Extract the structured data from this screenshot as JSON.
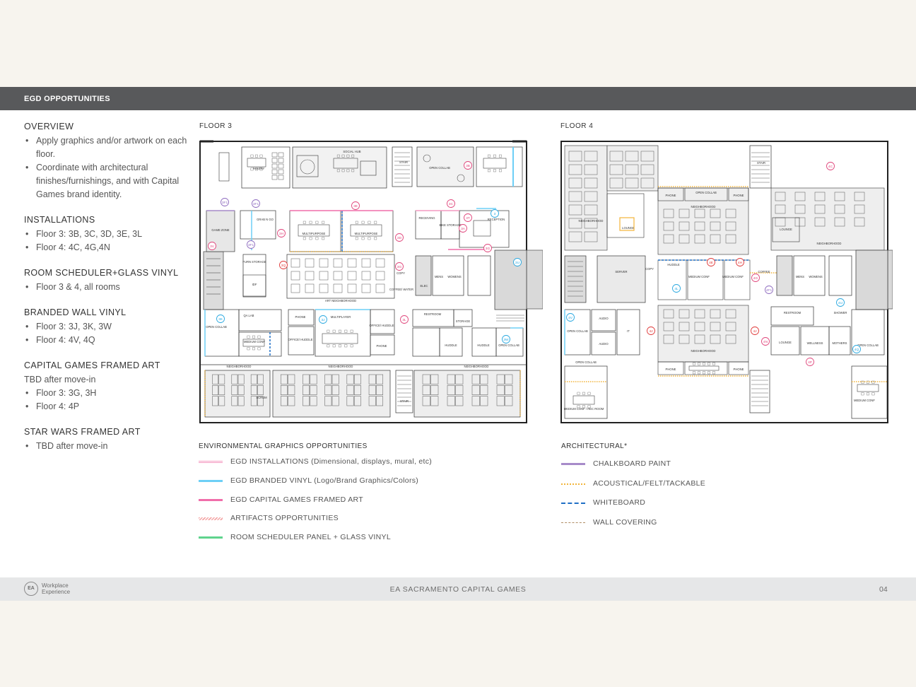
{
  "header": {
    "title": "EGD OPPORTUNITIES"
  },
  "sidebar": {
    "sections": [
      {
        "title": "OVERVIEW",
        "sub": "",
        "items": [
          "Apply graphics and/or artwork on each floor.",
          "Coordinate with architectural finishes/furnishings, and with Capital Games brand identity."
        ]
      },
      {
        "title": "INSTALLATIONS",
        "sub": "",
        "items": [
          "Floor 3: 3B, 3C, 3D, 3E, 3L",
          "Floor 4: 4C, 4G,4N"
        ]
      },
      {
        "title": "ROOM SCHEDULER+GLASS VINYL",
        "sub": "",
        "items": [
          "Floor 3 & 4, all rooms"
        ]
      },
      {
        "title": "BRANDED WALL VINYL",
        "sub": "",
        "items": [
          "Floor 3: 3J, 3K, 3W",
          "Floor 4: 4V, 4Q"
        ]
      },
      {
        "title": "CAPITAL GAMES FRAMED ART",
        "sub": "TBD after move-in",
        "items": [
          "Floor 3: 3G, 3H",
          "Floor 4: 4P"
        ]
      },
      {
        "title": "STAR WARS FRAMED ART",
        "sub": "",
        "items": [
          "TBD after move-in"
        ]
      }
    ]
  },
  "floors": {
    "floor3": {
      "label": "FLOOR 3",
      "rooms": [
        "PANTRY",
        "SOCIAL HUB",
        "STAIR",
        "OPEN COLLAB",
        "GAME ZONE",
        "GRAB N GO",
        "MULTIPURPOSE",
        "MULTIPURPOSE",
        "RECEIVING",
        "BIKE STORAGE",
        "RECEPTION",
        "FURN STORAGE",
        "IDF",
        "COPY",
        "COFFEE/ WATER",
        "ELEC",
        "MENS",
        "WOMENS",
        "ART NEIGHBORHOOD",
        "QA LAB",
        "OPEN COLLAB",
        "MEDIUM CONF",
        "PHONE",
        "MULTIPLAYER",
        "OFFICE/ HUDDLE",
        "OFFICE/ HUDDLE",
        "PHONE",
        "RESTROOM",
        "STORAGE",
        "HUDDLE",
        "HUDDLE",
        "OPEN COLLAB",
        "NEIGHBORHOOD",
        "NEIGHBORHOOD",
        "NEIGHBORHOOD",
        "SCRUM",
        "STAIR"
      ],
      "tags": [
        "3F1",
        "3F1",
        "3F1",
        "3E",
        "3C",
        "3B",
        "3T",
        "3",
        "3A",
        "3H",
        "3D",
        "3G",
        "3G",
        "3V",
        "3Q",
        "3U",
        "3K",
        "3J",
        "3L",
        "3W"
      ]
    },
    "floor4": {
      "label": "FLOOR 4",
      "rooms": [
        "STAIR",
        "PHONE",
        "OPEN COLLAB",
        "PHONE",
        "NEIGHBORHOOD",
        "NEIGHBORHOOD",
        "NEIGHBORHOOD",
        "LOUNGE",
        "LOUNGE",
        "SERVER",
        "COPY",
        "HUDDLE",
        "MEDIUM CONF",
        "MEDIUM CONF",
        "COFFEE",
        "MENS",
        "WOMENS",
        "RESTROOM",
        "SHOWER",
        "AUDIO",
        "AUDIO",
        "IT",
        "OPEN COLLAB",
        "NEIGHBORHOOD",
        "LOUNGE",
        "WELLNESS",
        "MOTHERS",
        "OPEN COLLAB",
        "PHONE",
        "PHONE",
        "OPEN COLLAB",
        "MEDIUM CONF / REC ROOM",
        "MEDIUM CONF"
      ],
      "tags": [
        "4C",
        "4F1",
        "4G",
        "4E",
        "4H",
        "4L",
        "4U",
        "4V",
        "4J",
        "4J",
        "4N",
        "4Q",
        "4P"
      ]
    }
  },
  "legend_egd": {
    "title": "ENVIRONMENTAL GRAPHICS OPPORTUNITIES",
    "items": [
      {
        "label": "EGD INSTALLATIONS (Dimensional, displays, mural, etc)",
        "color": "#f49ac1"
      },
      {
        "label": "EGD BRANDED VINYL (Logo/Brand Graphics/Colors)",
        "color": "#6dcff6"
      },
      {
        "label": "EGD CAPITAL GAMES FRAMED ART",
        "color": "#f06eaa"
      },
      {
        "label": "ARTIFACTS OPPORTUNITIES",
        "color": "#f4a6a6"
      },
      {
        "label": "ROOM SCHEDULER PANEL + GLASS VINYL",
        "color": "#5fd38d"
      }
    ]
  },
  "legend_arch": {
    "title": "ARCHITECTURAL*",
    "items": [
      {
        "label": "CHALKBOARD PAINT",
        "color": "#a78bc9"
      },
      {
        "label": "ACOUSTICAL/FELT/TACKABLE",
        "color": "#f2b43a"
      },
      {
        "label": "WHITEBOARD",
        "color": "#1f6fc5"
      },
      {
        "label": "WALL COVERING",
        "color": "#b08d64"
      }
    ]
  },
  "footer": {
    "logo": "EA",
    "brand_line1": "Workplace",
    "brand_line2": "Experience",
    "center": "EA SACRAMENTO CAPITAL GAMES",
    "page": "04"
  }
}
